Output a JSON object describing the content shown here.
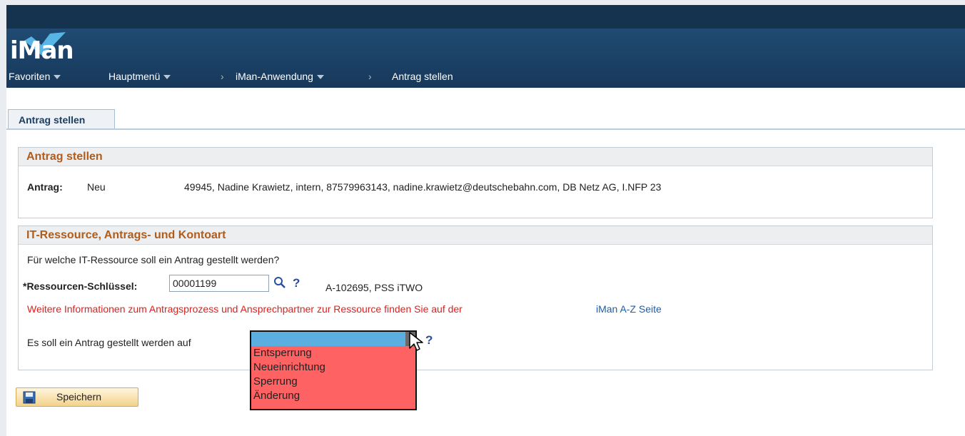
{
  "header": {
    "logo_text": "iMan",
    "nav": [
      {
        "label": "Favoriten"
      },
      {
        "label": "Hauptmenü"
      },
      {
        "label": "iMan-Anwendung"
      },
      {
        "label": "Antrag stellen"
      }
    ]
  },
  "tab": {
    "label": "Antrag stellen"
  },
  "section1": {
    "title": "Antrag stellen",
    "antrag_label": "Antrag:",
    "antrag_value": "Neu",
    "person_info": "49945, Nadine Krawietz, intern, 87579963143, nadine.krawietz@deutschebahn.com, DB Netz AG, I.NFP 23"
  },
  "section2": {
    "title": "IT-Ressource, Antrags- und Kontoart",
    "question": "Für welche IT-Ressource soll ein Antrag gestellt werden?",
    "resource_label": "*Ressourcen-Schlüssel:",
    "resource_value": "00001199",
    "resource_desc": "A-102695, PSS iTWO",
    "info_text": "Weitere Informationen zum Antragsprozess und Ansprechpartner zur Ressource finden Sie auf der",
    "info_link": "iMan A-Z Seite",
    "request_label": "Es soll ein Antrag gestellt werden auf",
    "help_symbol": "?",
    "dropdown": {
      "selected": "",
      "options": [
        "Entsperrung",
        "Neueinrichtung",
        "Sperrung",
        "Änderung"
      ]
    }
  },
  "save_button": {
    "label": "Speichern"
  },
  "colors": {
    "header_bg": "#1b3f62",
    "section_title": "#b05c1c",
    "info_text": "#e0201c",
    "link": "#1f5da8",
    "dropdown_bg": "#ff6262",
    "dropdown_selected": "#5aaee0"
  }
}
